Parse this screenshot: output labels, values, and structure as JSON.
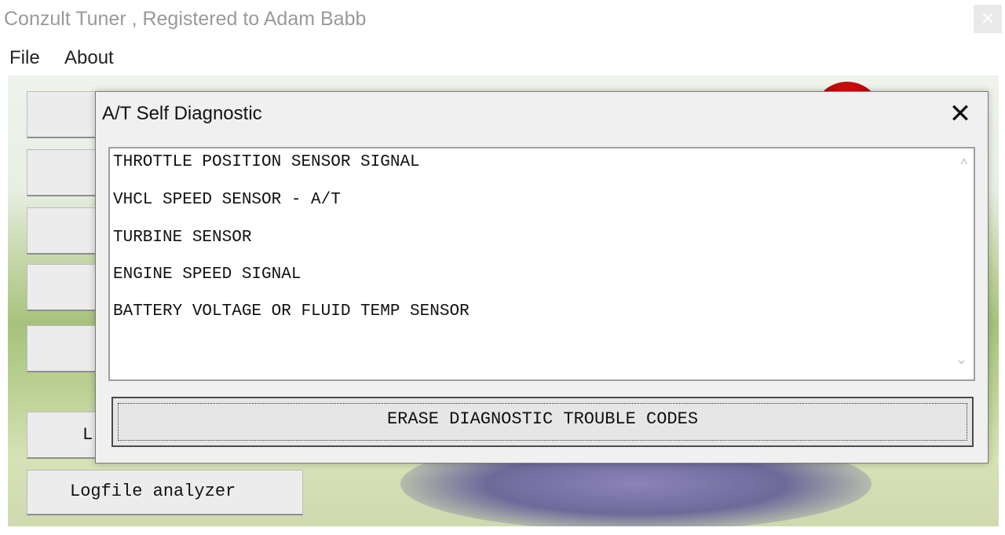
{
  "window": {
    "title": "Conzult Tuner ,  Registered to Adam Babb"
  },
  "menu": {
    "items": [
      "File",
      "About"
    ]
  },
  "side_buttons": {
    "partial_label": "L",
    "logfile_analyzer": "Logfile analyzer"
  },
  "dialog": {
    "title": "A/T Self Diagnostic",
    "close_glyph": "✕",
    "list_items": [
      "THROTTLE POSITION SENSOR SIGNAL",
      "VHCL SPEED SENSOR - A/T",
      "TURBINE SENSOR",
      "ENGINE SPEED SIGNAL",
      "BATTERY VOLTAGE OR FLUID TEMP SENSOR"
    ],
    "erase_button": "ERASE DIAGNOSTIC TROUBLE CODES"
  },
  "icons": {
    "scroll_up": "chevron-up-icon",
    "scroll_down": "chevron-down-icon",
    "close": "close-icon"
  }
}
